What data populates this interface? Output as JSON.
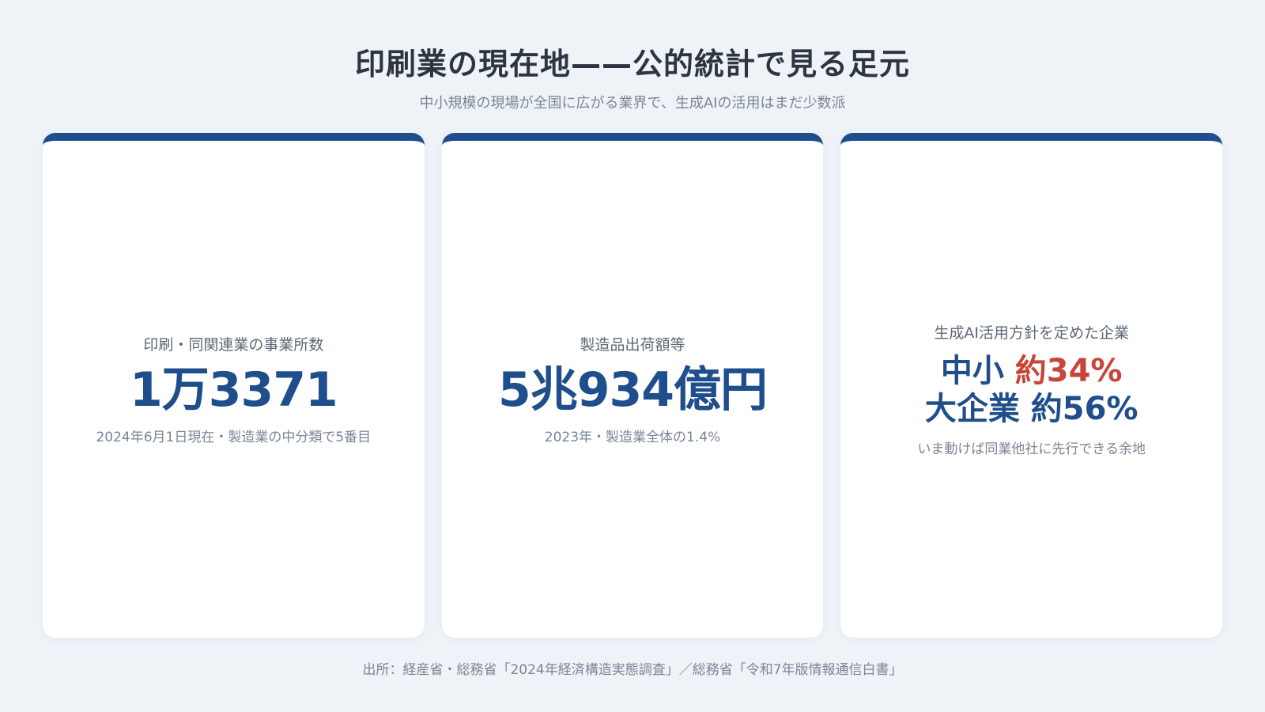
{
  "header": {
    "title": "印刷業の現在地——公的統計で見る足元",
    "subtitle": "中小規模の現場が全国に広がる業界で、生成AIの活用はまだ少数派"
  },
  "cards": [
    {
      "label": "印刷・同関連業の事業所数",
      "value": "1万3371",
      "note": "2024年6月1日現在・製造業の中分類で5番目"
    },
    {
      "label": "製造品出荷額等",
      "value": "5兆934億円",
      "note": "2023年・製造業全体の1.4%"
    },
    {
      "label": "生成AI活用方針を定めた企業",
      "line1_prefix": "中小",
      "line1_value": "約34%",
      "line2_prefix": "大企業",
      "line2_value": "約56%",
      "note": "いま動けば同業他社に先行できる余地"
    }
  ],
  "footer": {
    "source": "出所：経産省・総務省「2024年経済構造実態調査」／総務省「令和7年版情報通信白書」"
  },
  "colors": {
    "accent_blue": "#1f4e8c",
    "accent_red": "#c8453a",
    "background": "#eff3f8"
  }
}
